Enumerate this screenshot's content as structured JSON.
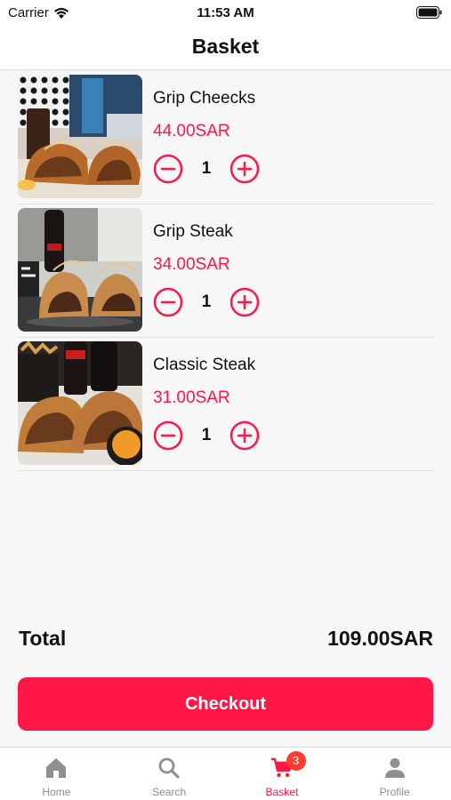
{
  "status_bar": {
    "carrier": "Carrier",
    "time": "11:53 AM"
  },
  "header": {
    "title": "Basket"
  },
  "items": [
    {
      "name": "Grip Cheecks",
      "price": "44.00SAR",
      "quantity": "1"
    },
    {
      "name": "Grip Steak",
      "price": "34.00SAR",
      "quantity": "1"
    },
    {
      "name": "Classic Steak",
      "price": "31.00SAR",
      "quantity": "1"
    }
  ],
  "summary": {
    "total_label": "Total",
    "total_value": "109.00SAR"
  },
  "checkout": {
    "label": "Checkout"
  },
  "tabbar": {
    "tabs": [
      {
        "label": "Home",
        "icon": "home-icon"
      },
      {
        "label": "Search",
        "icon": "search-icon"
      },
      {
        "label": "Basket",
        "icon": "cart-icon",
        "badge": "3",
        "active": true
      },
      {
        "label": "Profile",
        "icon": "person-icon"
      }
    ]
  },
  "colors": {
    "accent": "#ff1745",
    "badge": "#ff3b30",
    "inactive_tab": "#8e8e93"
  }
}
